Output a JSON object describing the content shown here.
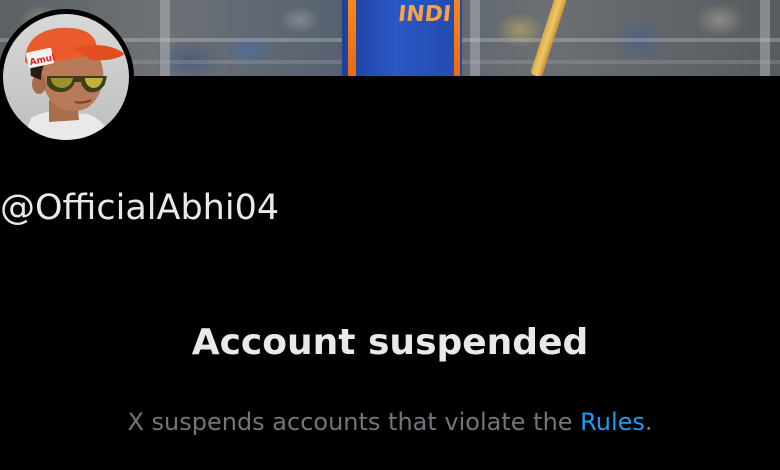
{
  "banner": {
    "jersey_text": "INDI"
  },
  "profile": {
    "avatar_cap_text": "Amul",
    "handle": "@OfficialAbhi04"
  },
  "status": {
    "title": "Account suspended",
    "note_prefix": "X suspends accounts that violate the ",
    "rules_link": "Rules",
    "note_suffix": "."
  },
  "colors": {
    "background": "#000000",
    "primary_text": "#e7e9ea",
    "secondary_text": "#71767b",
    "link": "#1d9bf0"
  }
}
